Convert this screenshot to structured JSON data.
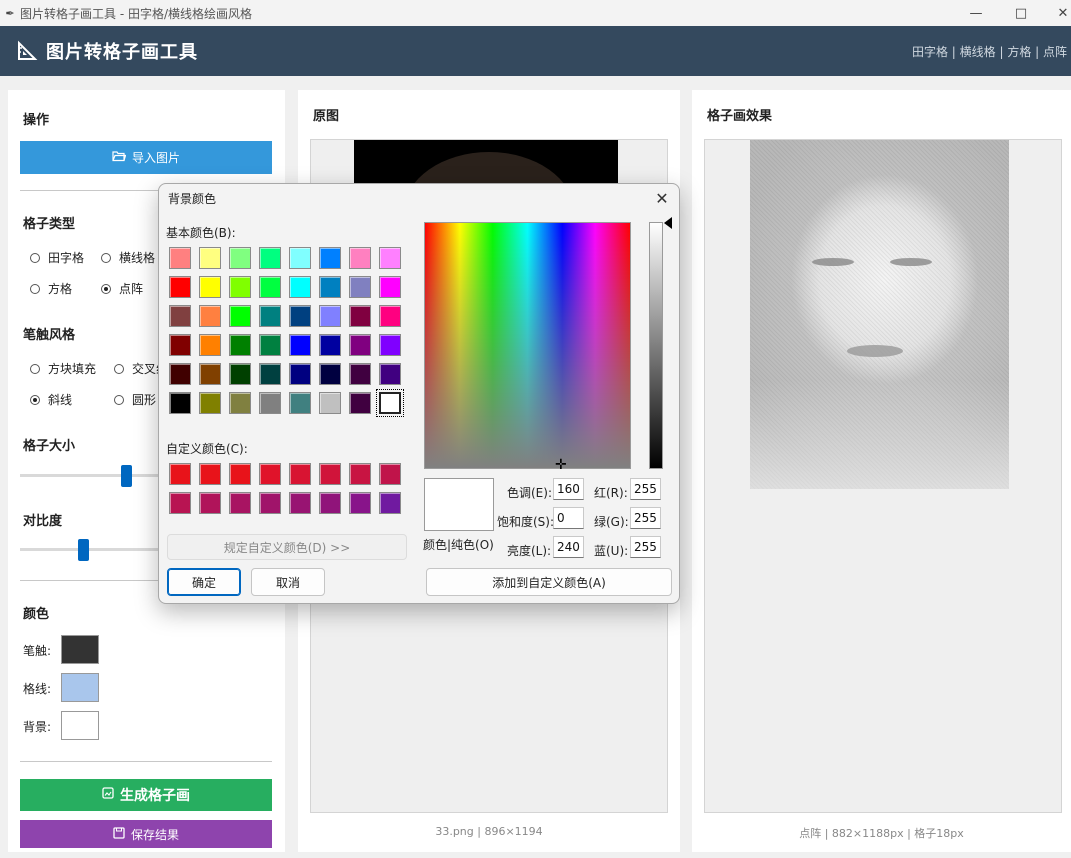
{
  "window": {
    "title": "图片转格子画工具 - 田字格/横线格绘画风格"
  },
  "header": {
    "app_name": "图片转格子画工具",
    "modes": "田字格 | 横线格 | 方格 | 点阵"
  },
  "left": {
    "ops_title": "操作",
    "import_label": "导入图片",
    "grid_type_title": "格子类型",
    "grid_types": [
      {
        "label": "田字格",
        "checked": false
      },
      {
        "label": "横线格",
        "checked": false
      },
      {
        "label": "方格",
        "checked": false
      },
      {
        "label": "点阵",
        "checked": true
      }
    ],
    "stroke_title": "笔触风格",
    "strokes": [
      {
        "label": "方块填充",
        "checked": false
      },
      {
        "label": "交叉线",
        "checked": false
      },
      {
        "label": "斜线",
        "checked": true
      },
      {
        "label": "圆形",
        "checked": false
      }
    ],
    "grid_size_title": "格子大小",
    "grid_size_value": 0.42,
    "contrast_title": "对比度",
    "contrast_value": 0.24,
    "color_title": "颜色",
    "colors": [
      {
        "label": "笔触:",
        "value": "#333333"
      },
      {
        "label": "格线:",
        "value": "#a9c6ec"
      },
      {
        "label": "背景:",
        "value": "#ffffff"
      }
    ],
    "generate_label": "生成格子画",
    "save_label": "保存结果"
  },
  "middle": {
    "title": "原图",
    "caption": "33.png | 896×1194"
  },
  "right": {
    "title": "格子画效果",
    "caption": "点阵 | 882×1188px | 格子18px"
  },
  "dialog": {
    "title": "背景颜色",
    "basic_label": "基本颜色(B):",
    "basic_colors": [
      "#ff8080",
      "#ffff80",
      "#80ff80",
      "#00ff80",
      "#80ffff",
      "#0080ff",
      "#ff80c0",
      "#ff80ff",
      "#ff0000",
      "#ffff00",
      "#80ff00",
      "#00ff40",
      "#00ffff",
      "#0080c0",
      "#8080c0",
      "#ff00ff",
      "#804040",
      "#ff8040",
      "#00ff00",
      "#008080",
      "#004080",
      "#8080ff",
      "#800040",
      "#ff0080",
      "#800000",
      "#ff8000",
      "#008000",
      "#008040",
      "#0000ff",
      "#0000a0",
      "#800080",
      "#8000ff",
      "#400000",
      "#804000",
      "#004000",
      "#004040",
      "#000080",
      "#000040",
      "#400040",
      "#400080",
      "#000000",
      "#808000",
      "#808040",
      "#808080",
      "#408080",
      "#c0c0c0",
      "#400040",
      "#ffffff"
    ],
    "custom_label": "自定义颜色(C):",
    "custom_colors": [
      "#e8131a",
      "#e8131a",
      "#e8131a",
      "#e0132a",
      "#d81432",
      "#d0143a",
      "#c81442",
      "#c0144a",
      "#b81452",
      "#b0145a",
      "#a81462",
      "#a0146a",
      "#981472",
      "#90147a",
      "#88148a",
      "#701aa0"
    ],
    "define_custom": "规定自定义颜色(D) >>",
    "ok": "确定",
    "cancel": "取消",
    "solid_label": "颜色|纯色(O)",
    "hue_label": "色调(E):",
    "hue": "160",
    "sat_label": "饱和度(S):",
    "sat": "0",
    "lum_label": "亮度(L):",
    "lum": "240",
    "red_label": "红(R):",
    "red": "255",
    "green_label": "绿(G):",
    "green": "255",
    "blue_label": "蓝(U):",
    "blue": "255",
    "add_custom": "添加到自定义颜色(A)",
    "current_color": "#ffffff"
  }
}
